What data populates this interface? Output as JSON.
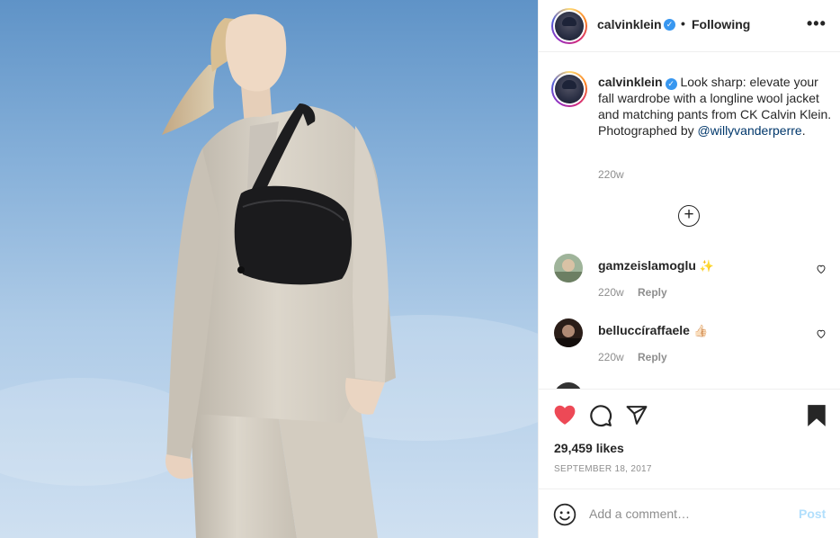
{
  "post": {
    "image_alt_icon": "fashion-photo",
    "colors": {
      "accent_blue": "#3897f0",
      "like_red": "#ed4956",
      "link": "#00376b",
      "muted": "#8e8e8e"
    }
  },
  "header": {
    "username": "calvinklein",
    "verified_icon": "verified-badge-icon",
    "separator": "•",
    "follow_state": "Following",
    "more_label": "•••"
  },
  "caption": {
    "username": "calvinklein",
    "text": " Look sharp: elevate your fall wardrobe with a longline wool jacket and matching pants from CK Calvin Klein. Photographed by ",
    "mention": "@willyvanderperre",
    "suffix": ".",
    "time": "220w"
  },
  "load_more_icon": "plus-circle-icon",
  "comments": [
    {
      "username": "gamzeislamoglu",
      "emoji": "✨",
      "time": "220w",
      "reply_label": "Reply"
    },
    {
      "username": "belluccíraffaele",
      "emoji": "👍🏻",
      "time": "220w",
      "reply_label": "Reply"
    }
  ],
  "actions": {
    "like_icon": "heart-filled-icon",
    "comment_icon": "comment-icon",
    "share_icon": "paper-plane-icon",
    "save_icon": "bookmark-filled-icon"
  },
  "likes": "29,459 likes",
  "date": "SEPTEMBER 18, 2017",
  "add_comment": {
    "emoji_icon": "smiley-icon",
    "placeholder": "Add a comment…",
    "post_label": "Post"
  }
}
